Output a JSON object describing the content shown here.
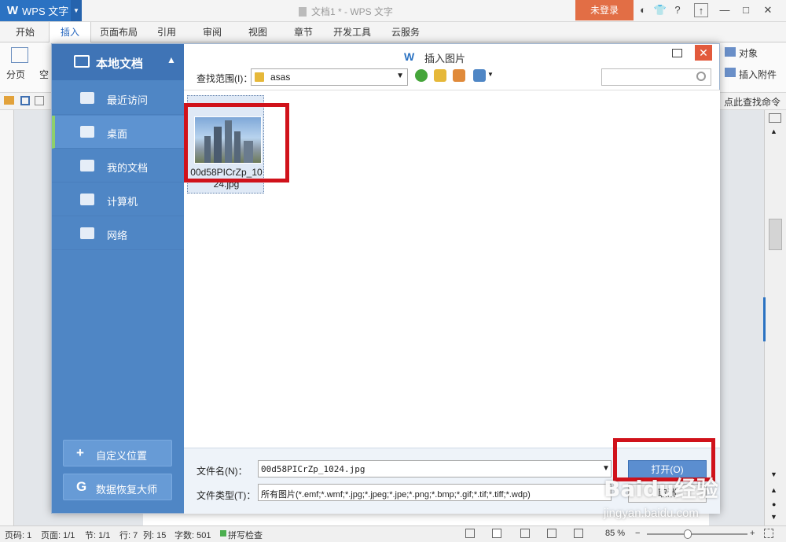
{
  "app": {
    "logo": "W",
    "name": "WPS 文字",
    "document_title": "文档1 * - WPS 文字",
    "login_label": "未登录",
    "help_label": "?"
  },
  "ribbon": {
    "tabs": [
      "开始",
      "插入",
      "页面布局",
      "引用",
      "审阅",
      "视图",
      "章节",
      "开发工具",
      "云服务"
    ],
    "active_tab": "插入",
    "page_break_label": "分页",
    "blank_page_label": "空",
    "object_label": "对象",
    "attachment_label": "插入附件",
    "command_search_label": "点此查找命令"
  },
  "dialog": {
    "title": "插入图片",
    "sidebar": {
      "header": "本地文档",
      "items": [
        {
          "label": "最近访问",
          "icon": "recent-icon"
        },
        {
          "label": "桌面",
          "icon": "desktop-icon"
        },
        {
          "label": "我的文档",
          "icon": "folder-icon"
        },
        {
          "label": "计算机",
          "icon": "computer-icon"
        },
        {
          "label": "网络",
          "icon": "network-icon"
        }
      ],
      "active_item": "桌面",
      "custom_location_label": "自定义位置",
      "recovery_label": "数据恢复大师"
    },
    "look_in_label": "查找范围(I)：",
    "look_in_value": "asas",
    "search_placeholder": "",
    "file": {
      "name": "00d58PICrZp_1024.jpg"
    },
    "filename_label": "文件名(N)：",
    "filename_value": "00d58PICrZp_1024.jpg",
    "filetype_label": "文件类型(T)：",
    "filetype_value": "所有图片(*.emf;*.wmf;*.jpg;*.jpeg;*.jpe;*.png;*.bmp;*.gif;*.tif;*.tiff;*.wdp)",
    "open_label": "打开(O)",
    "cancel_label": "取消",
    "colors": {
      "sidebar": "#4f86c5",
      "highlight": "#d0121b",
      "accent_green": "#8ed06b"
    }
  },
  "statusbar": {
    "page_code": "页码: 1",
    "pages": "页面: 1/1",
    "section": "节: 1/1",
    "row": "行: 7",
    "column": "列: 15",
    "word_count": "字数: 501",
    "spellcheck": "拼写检查",
    "zoom": "85 %"
  },
  "watermark": {
    "logo": "Baidu经验",
    "url": "jingyan.baidu.com"
  }
}
